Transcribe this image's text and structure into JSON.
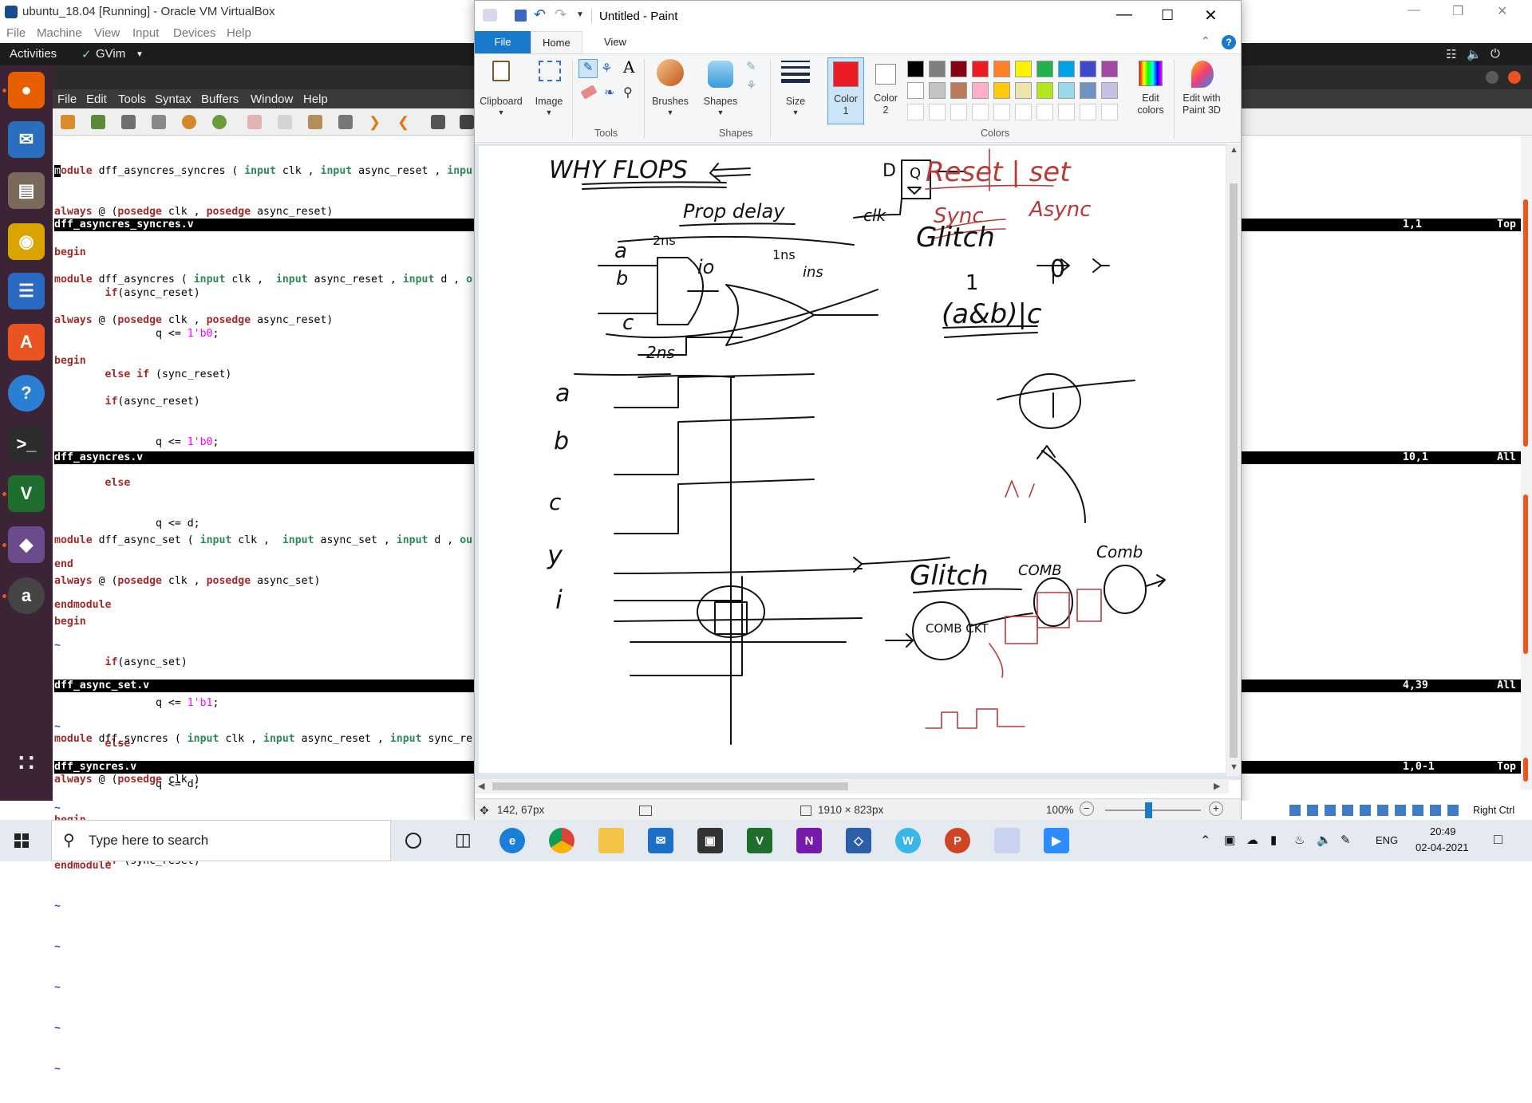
{
  "vbox": {
    "title": "ubuntu_18.04 [Running] - Oracle VM VirtualBox",
    "menu": [
      "File",
      "Machine",
      "View",
      "Input",
      "Devices",
      "Help"
    ],
    "host_key": "Right Ctrl"
  },
  "ubuntu": {
    "activities": "Activities",
    "app_name": "GVim"
  },
  "gvim": {
    "menu": [
      "File",
      "Edit",
      "Tools",
      "Syntax",
      "Buffers",
      "Window",
      "Help"
    ],
    "windows": [
      {
        "filename": "dff_asyncres_syncres.v",
        "position": "1,1",
        "scroll": "Top",
        "lines": [
          "module dff_asyncres_syncres ( input clk , input async_reset , inpu",
          "always @ (posedge clk , posedge async_reset)",
          "begin",
          "        if(async_reset)",
          "                q <= 1'b0;",
          "        else if (sync_reset)"
        ]
      },
      {
        "filename": "dff_asyncres.v",
        "position": "10,1",
        "scroll": "All",
        "lines": [
          "module dff_asyncres ( input clk ,  input async_reset , input d , o",
          "always @ (posedge clk , posedge async_reset)",
          "begin",
          "        if(async_reset)",
          "                q <= 1'b0;",
          "        else",
          "                q <= d;",
          "end",
          "endmodule",
          "~",
          "~",
          "~",
          "~",
          "~",
          "~"
        ]
      },
      {
        "filename": "dff_async_set.v",
        "position": "4,39",
        "scroll": "All",
        "lines": [
          "",
          "module dff_async_set ( input clk ,  input async_set , input d , ou",
          "always @ (posedge clk , posedge async_set)",
          "begin",
          "        if(async_set)",
          "                q <= 1'b1;",
          "        else",
          "                q <= d;",
          "end",
          "endmodule",
          "~",
          "~",
          "~",
          "~",
          "~"
        ]
      },
      {
        "filename": "dff_syncres.v",
        "position": "1,0-1",
        "scroll": "Top",
        "lines": [
          "module dff_syncres ( input clk , input async_reset , input sync_re",
          "always @ (posedge clk )",
          "begin",
          "        if (sync_reset)"
        ]
      }
    ]
  },
  "paint": {
    "title": "Untitled - Paint",
    "tabs": {
      "file": "File",
      "home": "Home",
      "view": "View"
    },
    "ribbon": {
      "clipboard": "Clipboard",
      "image": "Image",
      "tools": "Tools",
      "brushes": "Brushes",
      "shapes": "Shapes",
      "shapes_group": "Shapes",
      "size": "Size",
      "color1": "Color\n1",
      "color2": "Color\n2",
      "colors": "Colors",
      "edit_colors": "Edit\ncolors",
      "edit_3d": "Edit with\nPaint 3D"
    },
    "palette": [
      "#000000",
      "#7f7f7f",
      "#880015",
      "#ed1c24",
      "#ff7f27",
      "#fff200",
      "#22b14c",
      "#00a2e8",
      "#3f48cc",
      "#a349a4",
      "#ffffff",
      "#c3c3c3",
      "#b97a57",
      "#ffaec9",
      "#ffc90e",
      "#efe4b0",
      "#b5e61d",
      "#99d9ea",
      "#7092be",
      "#c8bfe7"
    ],
    "color1": "#ed1c24",
    "color2": "#ffffff",
    "status": {
      "cursor": "142, 67px",
      "size": "1910 × 823px",
      "zoom": "100%"
    },
    "drawing_text": {
      "heading": "WHY FLOPS",
      "prop": "Prop delay",
      "glitch": "Glitch",
      "glitch2": "Glitch",
      "reset": "Reset | set",
      "sync": "Sync",
      "async": "Async",
      "expr": "(a&b)|c",
      "comb": "COMB CKT",
      "comb2": "COMB",
      "comb3": "Comb",
      "d": "D",
      "q": "Q",
      "clk": "clk",
      "a": "a",
      "b": "b",
      "c": "c",
      "y": "y",
      "i": "i",
      "t2ns": "2ns",
      "t1ns": "1ns",
      "t2ns_b": "2ns",
      "sig_a": "a",
      "sig_b": "b",
      "io": "io",
      "ins": "ins",
      "zero": "0",
      "one": "1"
    }
  },
  "taskbar": {
    "search_placeholder": "Type here to search",
    "lang": "ENG",
    "time": "20:49",
    "date": "02-04-2021"
  }
}
